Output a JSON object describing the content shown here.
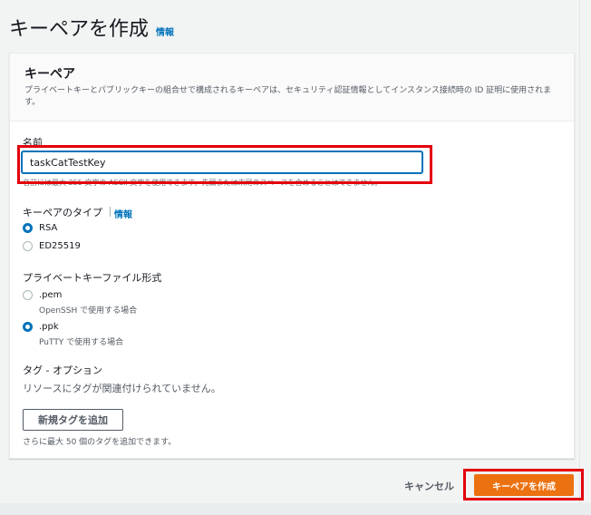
{
  "page": {
    "title": "キーペアを作成",
    "info_link": "情報"
  },
  "card": {
    "title": "キーペア",
    "description": "プライベートキーとパブリックキーの組合せで構成されるキーペアは、セキュリティ認証情報としてインスタンス接続時の ID 証明に使用されます。"
  },
  "name_field": {
    "label": "名前",
    "value": "taskCatTestKey",
    "hint": "名前には最大 255 文字の ASCII 文字を使用できます。先頭または末尾のスペースを含めることはできません。"
  },
  "key_type": {
    "label": "キーペアのタイプ",
    "info_link": "情報",
    "selected": "RSA",
    "options": [
      {
        "label": "RSA",
        "checked": true
      },
      {
        "label": "ED25519",
        "checked": false
      }
    ]
  },
  "file_format": {
    "label": "プライベートキーファイル形式",
    "selected": ".ppk",
    "options": [
      {
        "label": ".pem",
        "sub": "OpenSSH で使用する場合",
        "checked": false
      },
      {
        "label": ".ppk",
        "sub": "PuTTY で使用する場合",
        "checked": true
      }
    ]
  },
  "tags": {
    "label": "タグ - オプション",
    "empty_text": "リソースにタグが関連付けられていません。",
    "add_button": "新規タグを追加",
    "limit_text": "さらに最大 50 個のタグを追加できます。"
  },
  "footer": {
    "cancel": "キャンセル",
    "submit": "キーペアを作成"
  },
  "colors": {
    "accent": "#0073bb",
    "primary_button": "#ec7211",
    "highlight": "#e3000b"
  }
}
